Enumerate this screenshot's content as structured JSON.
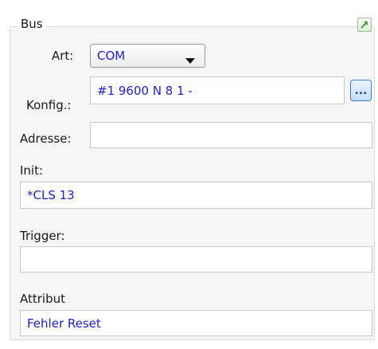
{
  "group": {
    "title": "Bus",
    "corner_icon": "expand-arrow-icon"
  },
  "art": {
    "label": "Art:",
    "value": "COM"
  },
  "konfig": {
    "label": "Konfig.:",
    "value": "#1 9600 N 8 1 -",
    "button_label": "..."
  },
  "adresse": {
    "label": "Adresse:",
    "value": ""
  },
  "init": {
    "label": "Init:",
    "value": "*CLS 13"
  },
  "trigger": {
    "label": "Trigger:",
    "value": ""
  },
  "attribut": {
    "label": "Attribut",
    "value": "Fehler Reset"
  },
  "colors": {
    "value_text": "#1f1fd0",
    "panel": "#f5f5f5",
    "accent": "#3d7fc4"
  }
}
